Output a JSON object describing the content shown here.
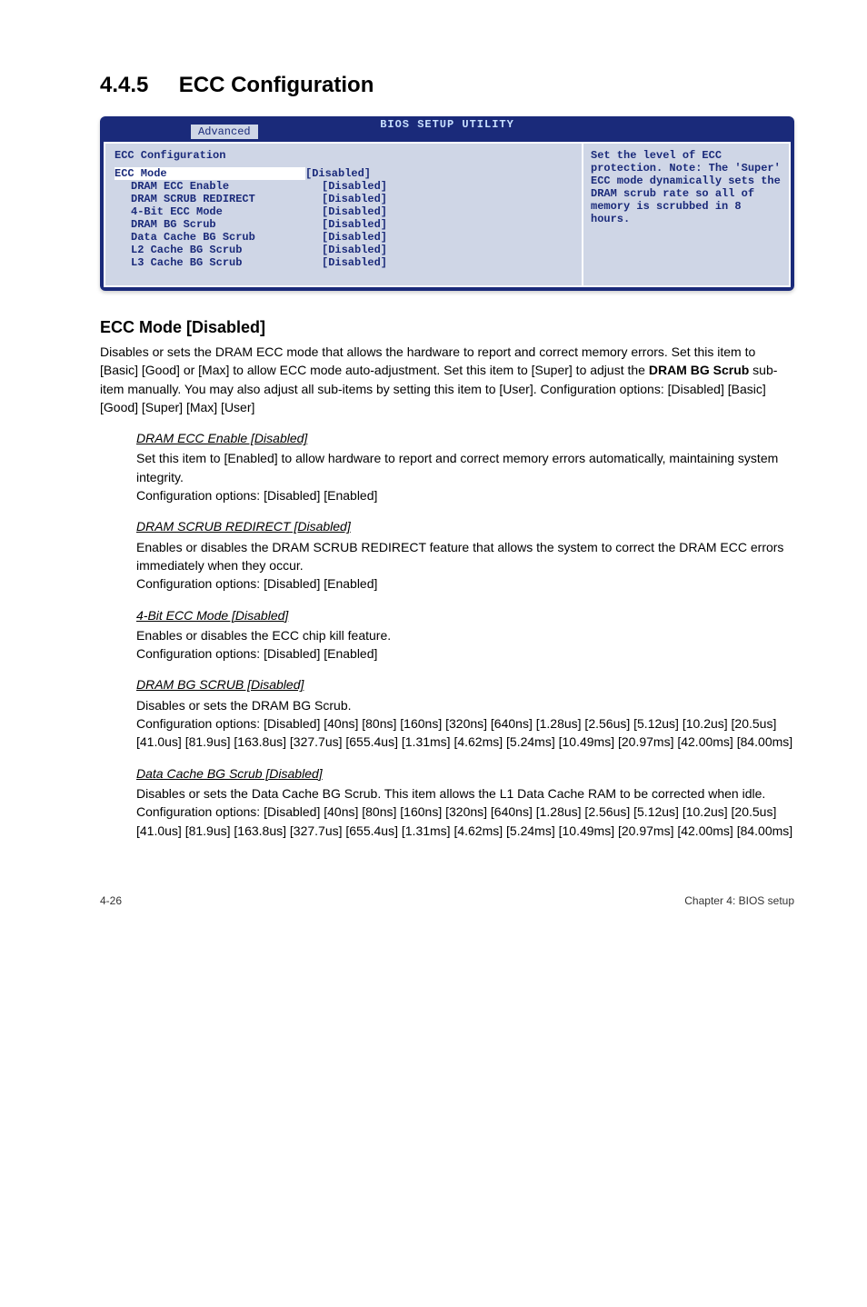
{
  "section": {
    "number": "4.4.5",
    "title": "ECC Configuration"
  },
  "bios": {
    "title": "BIOS SETUP UTILITY",
    "tab": "Advanced",
    "panel_title": "ECC Configuration",
    "rows": [
      {
        "label": "ECC Mode",
        "value": "[Disabled]",
        "indent": false,
        "highlight": true
      },
      {
        "label": "DRAM ECC Enable",
        "value": "[Disabled]",
        "indent": true,
        "highlight": false
      },
      {
        "label": "DRAM SCRUB REDIRECT",
        "value": "[Disabled]",
        "indent": true,
        "highlight": false
      },
      {
        "label": "4-Bit ECC Mode",
        "value": "[Disabled]",
        "indent": true,
        "highlight": false
      },
      {
        "label": "DRAM BG Scrub",
        "value": "[Disabled]",
        "indent": true,
        "highlight": false
      },
      {
        "label": "Data Cache BG Scrub",
        "value": "[Disabled]",
        "indent": true,
        "highlight": false
      },
      {
        "label": "L2 Cache BG Scrub",
        "value": "[Disabled]",
        "indent": true,
        "highlight": false
      },
      {
        "label": "L3 Cache BG Scrub",
        "value": "[Disabled]",
        "indent": true,
        "highlight": false
      }
    ],
    "help": "Set the level of ECC protection. Note: The 'Super' ECC mode dynamically sets the DRAM scrub rate so all of memory is scrubbed in 8 hours."
  },
  "ecc_mode": {
    "heading": "ECC Mode [Disabled]",
    "para1": "Disables or sets the DRAM ECC mode that allows the hardware to report and correct memory errors. Set this item to [Basic] [Good] or [Max] to allow ECC mode auto-adjustment. Set this item to [Super] to adjust the ",
    "bold": "DRAM BG Scrub",
    "para2": " sub-item manually. You may also adjust all sub-items by setting this item to [User]. Configuration options: [Disabled] [Basic] [Good] [Super] [Max] [User]"
  },
  "subs": {
    "dram_ecc": {
      "title": "DRAM ECC Enable [Disabled]",
      "body": "Set this item to [Enabled] to allow hardware to report and correct memory errors automatically, maintaining system integrity.\nConfiguration options: [Disabled] [Enabled]"
    },
    "scrub_redirect": {
      "title": "DRAM SCRUB REDIRECT [Disabled]",
      "body": "Enables or disables the DRAM SCRUB REDIRECT feature that allows the system to correct the DRAM ECC errors immediately when they occur.\nConfiguration options: [Disabled] [Enabled]"
    },
    "four_bit": {
      "title": "4-Bit ECC Mode [Disabled]",
      "body": "Enables or disables the ECC chip kill feature.\nConfiguration options: [Disabled] [Enabled]"
    },
    "dram_bg": {
      "title": "DRAM BG SCRUB [Disabled]",
      "body": "Disables or sets the DRAM BG Scrub.\nConfiguration options: [Disabled] [40ns] [80ns] [160ns] [320ns] [640ns] [1.28us] [2.56us] [5.12us] [10.2us] [20.5us] [41.0us] [81.9us] [163.8us] [327.7us] [655.4us] [1.31ms] [4.62ms] [5.24ms] [10.49ms] [20.97ms] [42.00ms] [84.00ms]"
    },
    "data_cache": {
      "title": "Data Cache BG Scrub [Disabled]",
      "body": "Disables or sets the Data Cache BG Scrub. This item allows the L1 Data Cache RAM to be corrected when idle.\nConfiguration options: [Disabled] [40ns] [80ns] [160ns] [320ns] [640ns] [1.28us] [2.56us] [5.12us] [10.2us] [20.5us] [41.0us] [81.9us] [163.8us] [327.7us] [655.4us] [1.31ms] [4.62ms] [5.24ms] [10.49ms] [20.97ms] [42.00ms] [84.00ms]"
    }
  },
  "footer": {
    "left": "4-26",
    "right": "Chapter 4: BIOS setup"
  }
}
